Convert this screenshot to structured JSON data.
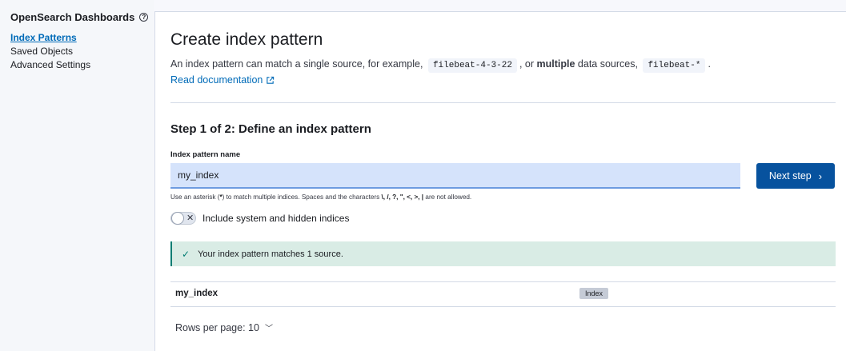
{
  "sidebar": {
    "title": "OpenSearch Dashboards",
    "help_icon": "?",
    "items": [
      {
        "label": "Index Patterns",
        "active": true
      },
      {
        "label": "Saved Objects",
        "active": false
      },
      {
        "label": "Advanced Settings",
        "active": false
      }
    ]
  },
  "main": {
    "title": "Create index pattern",
    "description": {
      "part1": "An index pattern can match a single source, for example,",
      "code1": "filebeat-4-3-22",
      "part2": ", or",
      "bold": "multiple",
      "part3": "data sources,",
      "code2": "filebeat-*",
      "part4": "."
    },
    "read_doc": "Read documentation",
    "step_title": "Step 1 of 2: Define an index pattern",
    "field_label": "Index pattern name",
    "input_value": "my_index",
    "next_button": "Next step",
    "hint": {
      "part1": "Use an asterisk (",
      "star": "*",
      "part2": ") to match multiple indices. Spaces and the characters",
      "chars": "\\, /, ?, \", <, >, |",
      "part3": "are not allowed."
    },
    "toggle_label": "Include system and hidden indices",
    "callout_text": "Your index pattern matches 1 source.",
    "table": {
      "rows": [
        {
          "name": "my_index",
          "badge": "Index"
        }
      ]
    },
    "rows_per_page": "Rows per page: 10"
  },
  "colors": {
    "link": "#006bb8",
    "primary_button": "#07529e",
    "success_callout_bg": "#d9ece5",
    "success_accent": "#017d73"
  },
  "icons": {
    "help": "help-icon",
    "external": "external-link-icon",
    "next": "chevron-right-icon",
    "toggle_off": "cross-icon",
    "check": "check-icon",
    "rows_dropdown": "chevron-down-icon"
  }
}
